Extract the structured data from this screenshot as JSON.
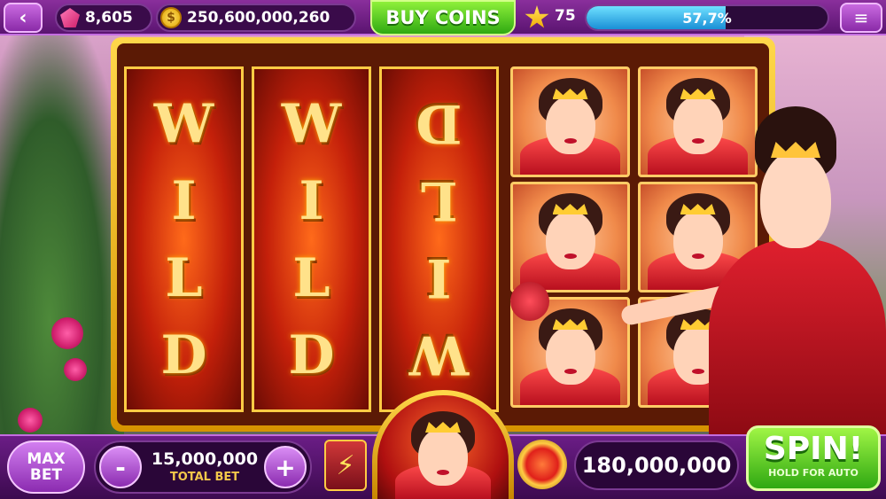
{
  "topbar": {
    "back_icon": "‹",
    "gems": "8,605",
    "coins": "250,600,000,260",
    "coin_symbol": "$",
    "buy_label": "BUY COINS",
    "level": "75",
    "xp_percent_text": "57,7%",
    "xp_fraction": 0.577,
    "menu_icon": "≡"
  },
  "reels": {
    "wild_letters": [
      "W",
      "I",
      "L",
      "D"
    ]
  },
  "bottombar": {
    "maxbet_label": "MAX\nBET",
    "minus": "-",
    "plus": "+",
    "bet_value": "15,000,000",
    "bet_label": "TOTAL BET",
    "boost_icon": "⚡",
    "win_value": "180,000,000",
    "spin_label": "SPIN!",
    "spin_sub": "HOLD FOR AUTO"
  },
  "colors": {
    "accent_purple": "#8a2aa8",
    "spin_green": "#2fa812",
    "gold": "#ffcc44"
  }
}
